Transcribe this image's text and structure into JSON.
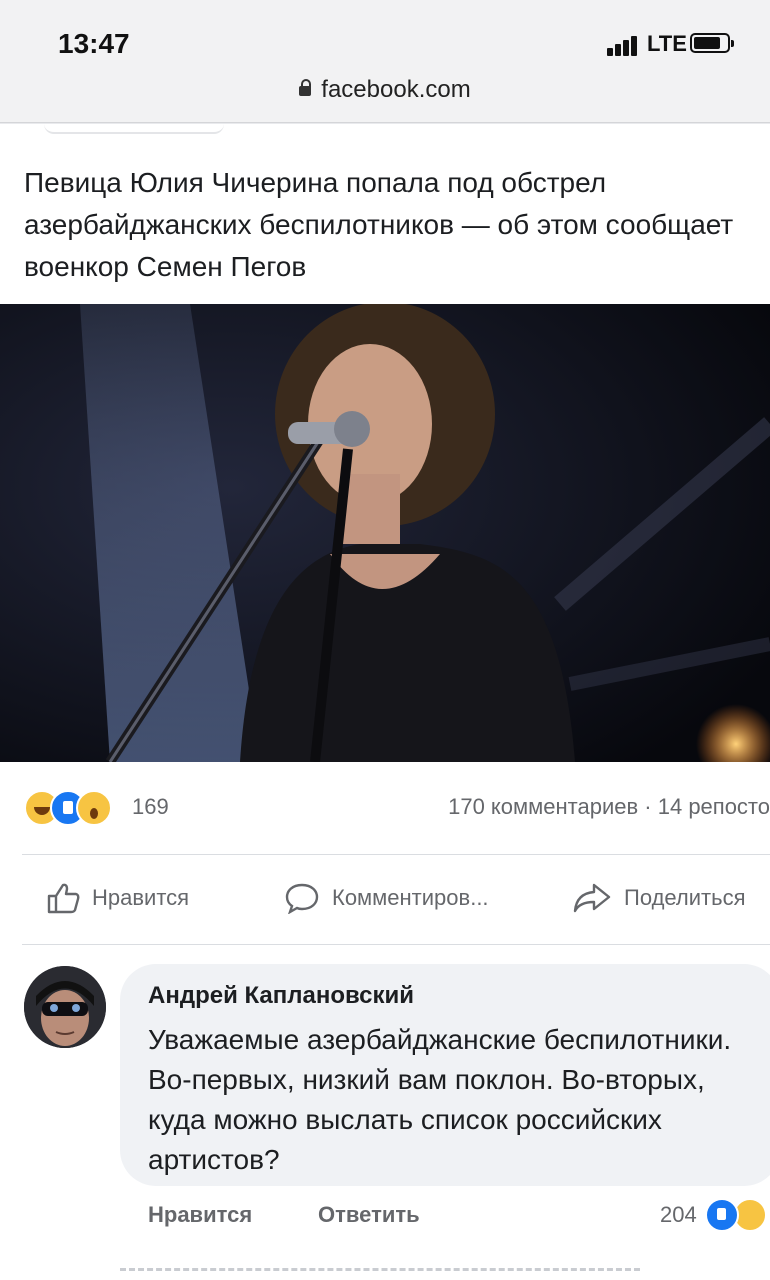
{
  "status_bar": {
    "time": "13:47",
    "network": "LTE"
  },
  "browser": {
    "url": "facebook.com"
  },
  "post": {
    "text": "Певица Юлия Чичерина попала под обстрел азербайджанских беспилотников — об этом сообщает военкор Семен Пегов",
    "reaction_count": "169",
    "comments_shares": "170 комментариев · 14 репосто",
    "actions": {
      "like": "Нравится",
      "comment": "Комментиров...",
      "share": "Поделиться"
    }
  },
  "comment": {
    "author": "Андрей Каплановский",
    "text": "Уважаемые азербайджанские беспилотники. Во-первых, низкий вам поклон. Во-вторых, куда можно выслать список российских артистов?",
    "like_label": "Нравится",
    "reply_label": "Ответить",
    "reaction_count": "204"
  },
  "colors": {
    "fb_blue": "#1877f2",
    "meta_gray": "#65676b"
  }
}
